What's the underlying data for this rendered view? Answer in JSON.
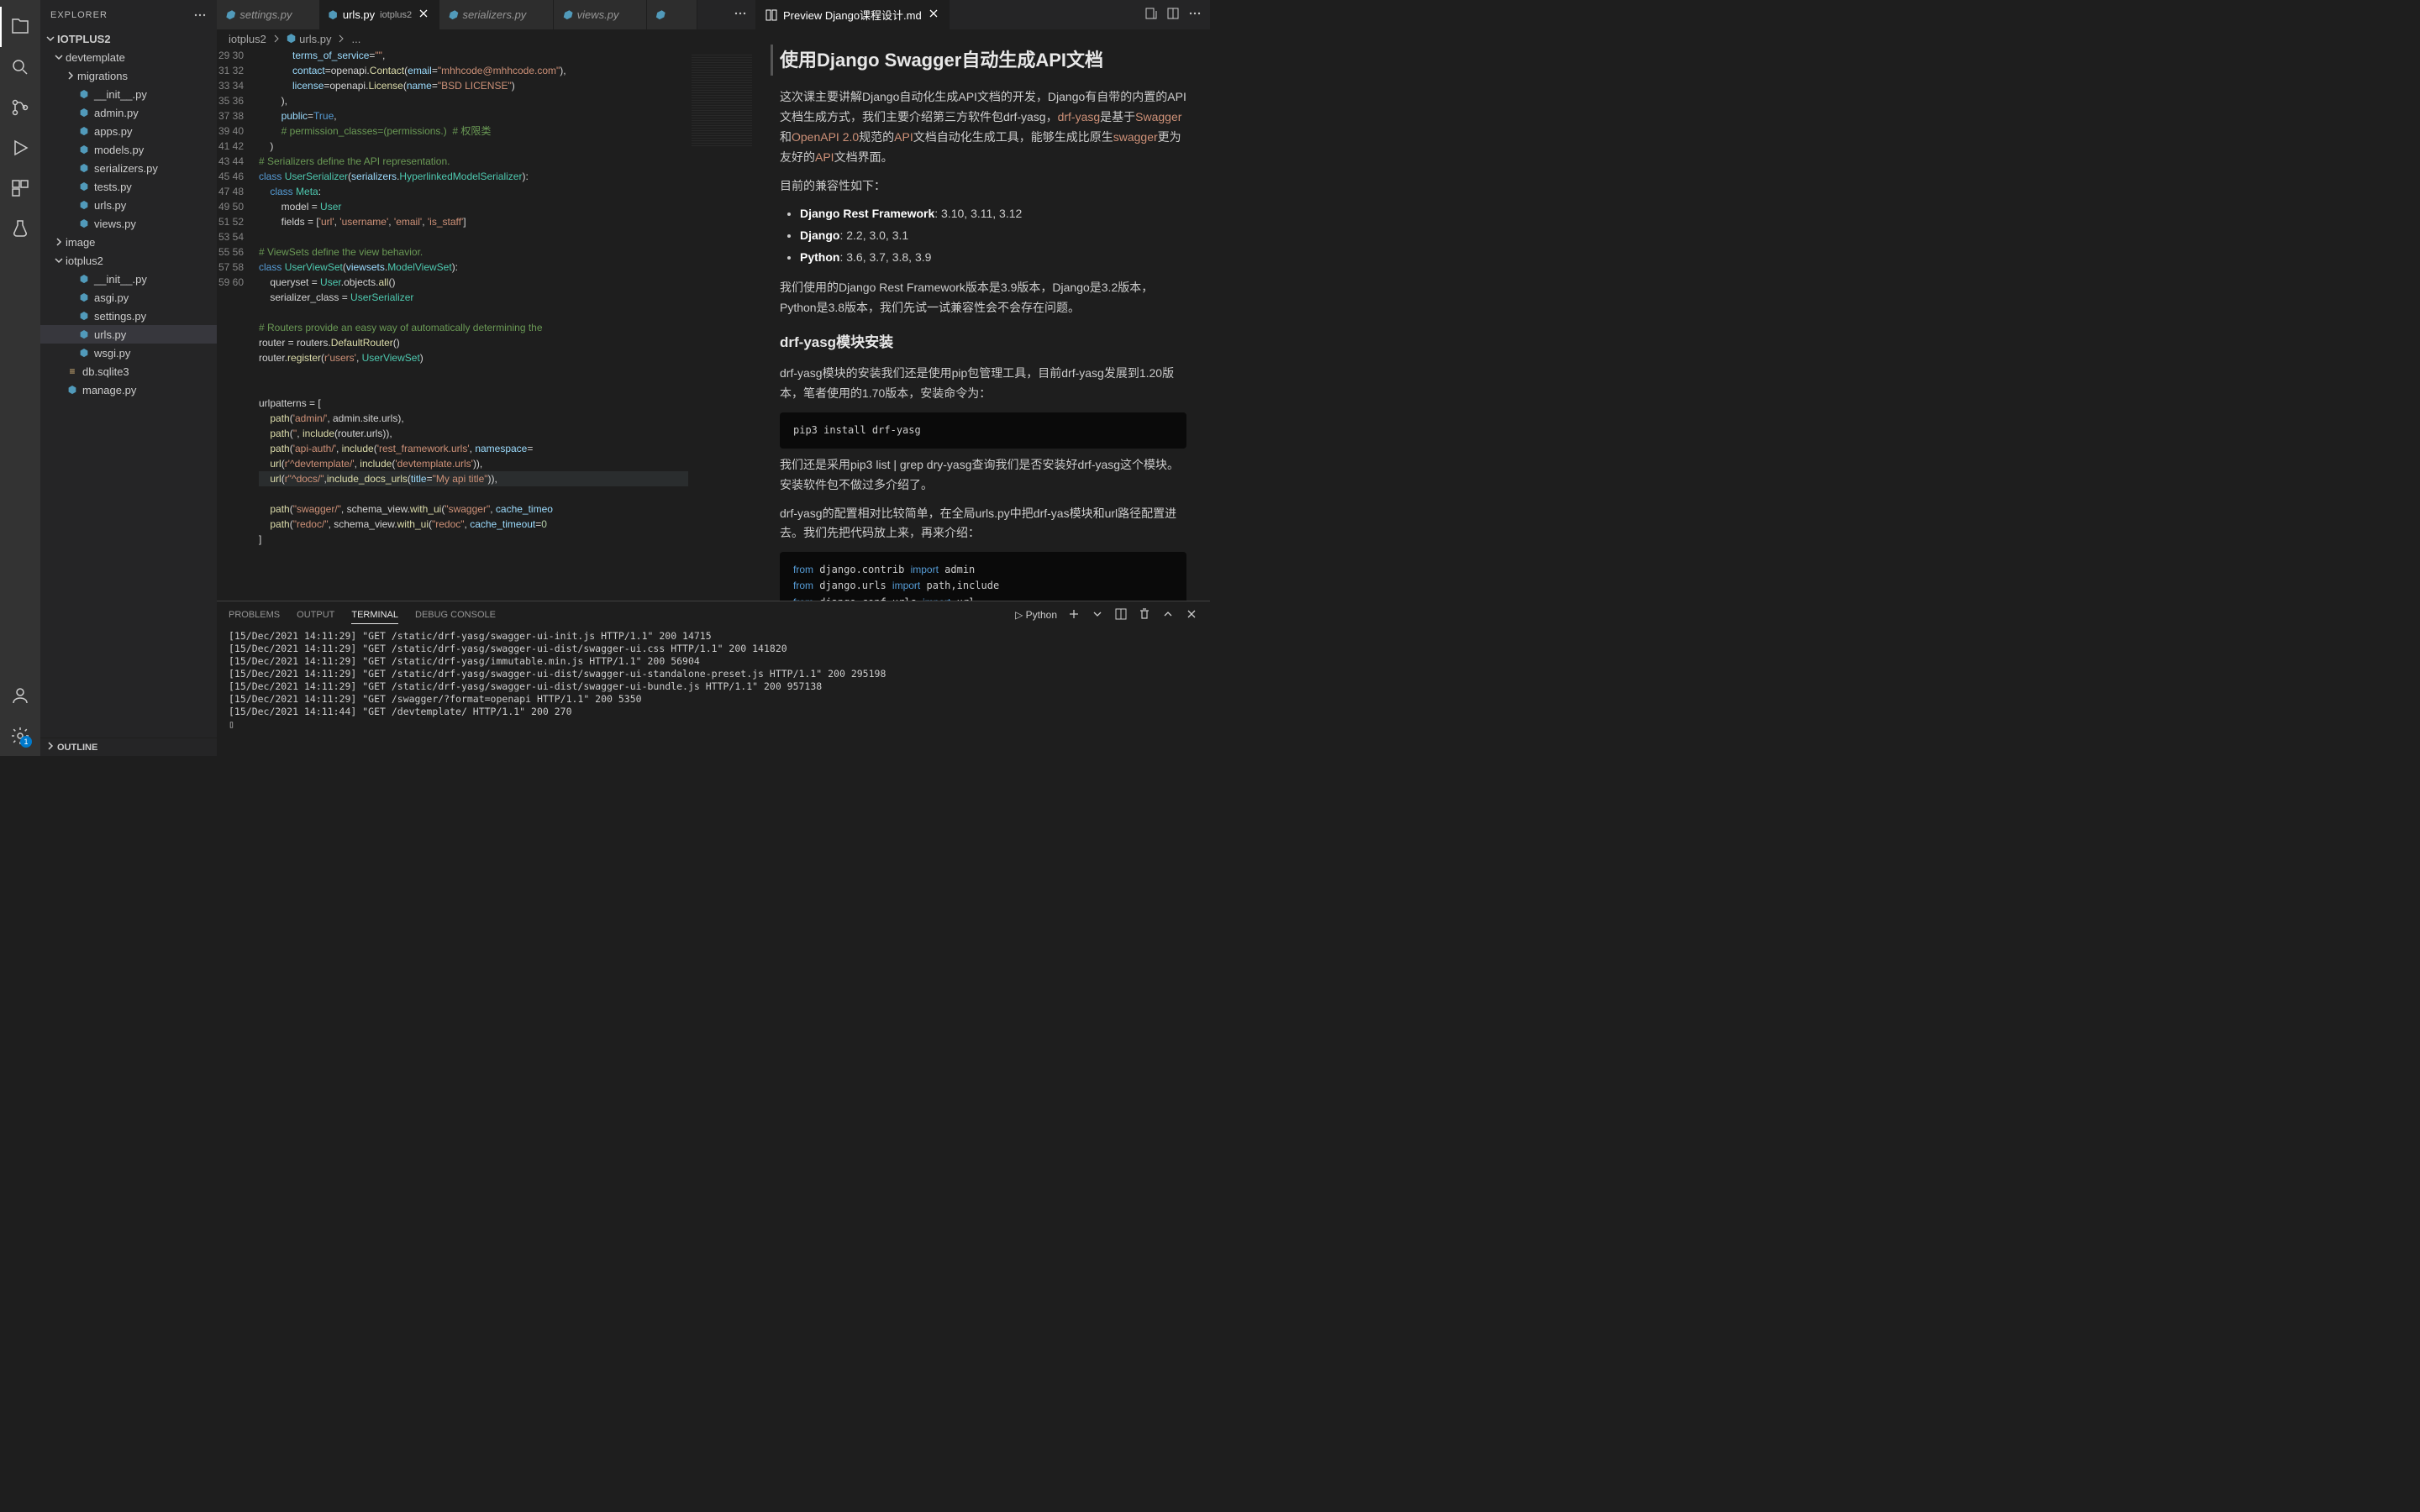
{
  "sidebar": {
    "title": "EXPLORER",
    "root": "IOTPLUS2",
    "outline": "OUTLINE",
    "tree": [
      {
        "label": "devtemplate",
        "depth": 0,
        "type": "folder",
        "open": true
      },
      {
        "label": "migrations",
        "depth": 1,
        "type": "folder",
        "open": false
      },
      {
        "label": "__init__.py",
        "depth": 1,
        "type": "py"
      },
      {
        "label": "admin.py",
        "depth": 1,
        "type": "py"
      },
      {
        "label": "apps.py",
        "depth": 1,
        "type": "py"
      },
      {
        "label": "models.py",
        "depth": 1,
        "type": "py"
      },
      {
        "label": "serializers.py",
        "depth": 1,
        "type": "py"
      },
      {
        "label": "tests.py",
        "depth": 1,
        "type": "py"
      },
      {
        "label": "urls.py",
        "depth": 1,
        "type": "py"
      },
      {
        "label": "views.py",
        "depth": 1,
        "type": "py"
      },
      {
        "label": "image",
        "depth": 0,
        "type": "folder",
        "open": false
      },
      {
        "label": "iotplus2",
        "depth": 0,
        "type": "folder",
        "open": true
      },
      {
        "label": "__init__.py",
        "depth": 1,
        "type": "py"
      },
      {
        "label": "asgi.py",
        "depth": 1,
        "type": "py"
      },
      {
        "label": "settings.py",
        "depth": 1,
        "type": "py"
      },
      {
        "label": "urls.py",
        "depth": 1,
        "type": "py",
        "selected": true
      },
      {
        "label": "wsgi.py",
        "depth": 1,
        "type": "py"
      },
      {
        "label": "db.sqlite3",
        "depth": 0,
        "type": "db"
      },
      {
        "label": "manage.py",
        "depth": 0,
        "type": "py"
      }
    ]
  },
  "tabs": [
    {
      "label": "settings.py",
      "kind": "py"
    },
    {
      "label": "urls.py",
      "sub": "iotplus2",
      "kind": "py",
      "active": true,
      "close": true
    },
    {
      "label": "serializers.py",
      "kind": "py"
    },
    {
      "label": "views.py",
      "kind": "py"
    },
    {
      "label": "",
      "kind": "py"
    }
  ],
  "breadcrumb": {
    "a": "iotplus2",
    "b": "urls.py",
    "c": "..."
  },
  "gutter_start": 29,
  "gutter_end": 60,
  "preview": {
    "tabTitle": "Preview Django课程设计.md",
    "h1": "使用Django Swagger自动生成API文档",
    "p1a": "这次课主要讲解Django自动化生成API文档的开发，Django有自带的内置的API文档生成方式，我们主要介绍第三方软件包drf-yasg，",
    "p1b": "drf-yasg",
    "p1c": "是基于",
    "p1d": "Swagger",
    "p1e": "和",
    "p1f": "OpenAPI 2.0",
    "p1g": "规范的",
    "p1h": "API",
    "p1i": "文档自动化生成工具，能够生成比原生",
    "p1j": "swagger",
    "p1k": "更为友好的",
    "p1l": "API",
    "p1m": "文档界面。",
    "compat": "目前的兼容性如下：",
    "li1a": "Django Rest Framework",
    "li1b": ": 3.10, 3.11, 3.12",
    "li2a": "Django",
    "li2b": ": 2.2, 3.0, 3.1",
    "li3a": "Python",
    "li3b": ": 3.6, 3.7, 3.8, 3.9",
    "p2": "我们使用的Django Rest Framework版本是3.9版本，Django是3.2版本，Python是3.8版本，我们先试一试兼容性会不会存在问题。",
    "h2a": "drf-yasg模块安装",
    "p3": "drf-yasg模块的安装我们还是使用pip包管理工具，目前drf-yasg发展到1.20版本，笔者使用的1.70版本，安装命令为：",
    "code1": "pip3 install drf-yasg",
    "p4": "我们还是采用pip3 list | grep dry-yasg查询我们是否安装好drf-yasg这个模块。安装软件包不做过多介绍了。",
    "p5": "drf-yasg的配置相对比较简单，在全局urls.py中把drf-yas模块和url路径配置进去。我们先把代码放上来，再来介绍：",
    "code2": "from django.contrib import admin\nfrom django.urls import path,include\nfrom django.conf.urls import url\nfrom django.conf import settings"
  },
  "panel": {
    "tabs": [
      "PROBLEMS",
      "OUTPUT",
      "TERMINAL",
      "DEBUG CONSOLE"
    ],
    "kernel": "Python",
    "lines": [
      "[15/Dec/2021 14:11:29] \"GET /static/drf-yasg/swagger-ui-init.js HTTP/1.1\" 200 14715",
      "[15/Dec/2021 14:11:29] \"GET /static/drf-yasg/swagger-ui-dist/swagger-ui.css HTTP/1.1\" 200 141820",
      "[15/Dec/2021 14:11:29] \"GET /static/drf-yasg/immutable.min.js HTTP/1.1\" 200 56904",
      "[15/Dec/2021 14:11:29] \"GET /static/drf-yasg/swagger-ui-dist/swagger-ui-standalone-preset.js HTTP/1.1\" 200 295198",
      "[15/Dec/2021 14:11:29] \"GET /static/drf-yasg/swagger-ui-dist/swagger-ui-bundle.js HTTP/1.1\" 200 957138",
      "[15/Dec/2021 14:11:29] \"GET /swagger/?format=openapi HTTP/1.1\" 200 5350",
      "[15/Dec/2021 14:11:44] \"GET /devtemplate/ HTTP/1.1\" 200 270"
    ]
  },
  "settings_badge": "1"
}
